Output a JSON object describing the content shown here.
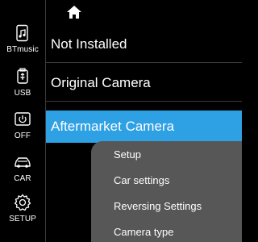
{
  "sidebar": {
    "items": [
      {
        "label": "BTmusic",
        "icon": "bt-music-icon"
      },
      {
        "label": "USB",
        "icon": "usb-icon"
      },
      {
        "label": "OFF",
        "icon": "power-icon"
      },
      {
        "label": "CAR",
        "icon": "car-icon"
      },
      {
        "label": "SETUP",
        "icon": "gear-icon"
      }
    ]
  },
  "header": {
    "icon": "home-icon"
  },
  "options": {
    "items": [
      {
        "label": "Not Installed"
      },
      {
        "label": "Original Camera"
      },
      {
        "label": "Aftermarket Camera"
      }
    ],
    "selected_index": 2
  },
  "popup": {
    "items": [
      {
        "label": "Setup"
      },
      {
        "label": "Car settings"
      },
      {
        "label": "Reversing Settings"
      },
      {
        "label": "Camera type"
      }
    ]
  },
  "colors": {
    "accent": "#2ea0e4",
    "popup_bg": "#575757",
    "background": "#000000"
  }
}
